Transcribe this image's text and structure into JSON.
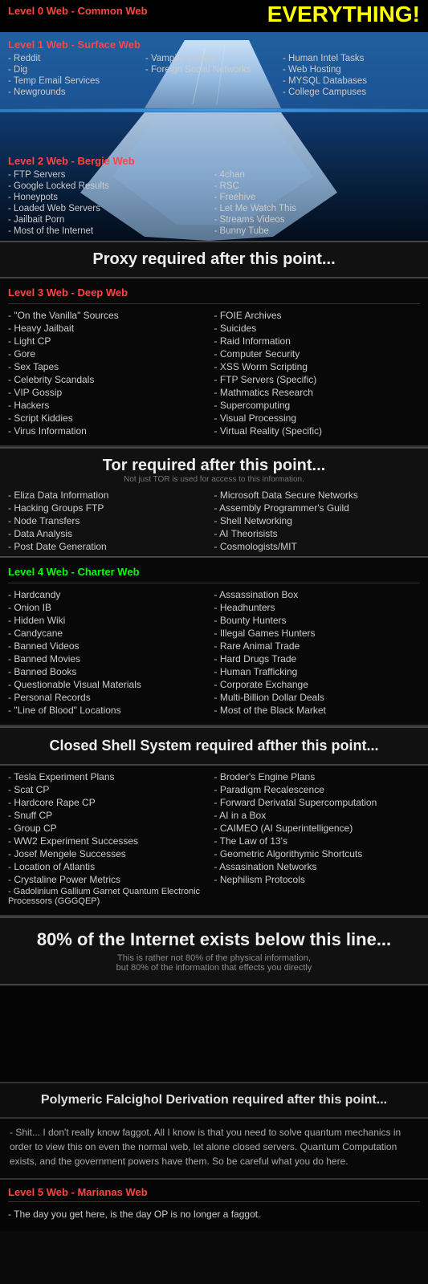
{
  "top": {
    "level0_label": "Level 0 Web - Common Web",
    "everything_label": "EVERYTHING!"
  },
  "level1": {
    "header": "Level 1 Web - Surface Web",
    "col1": [
      "- Reddit",
      "- Dig",
      "- Temp Email Services",
      "- Newgrounds"
    ],
    "col2": [
      "- Vampire Freaks",
      "- Foreign Social Networks"
    ],
    "col3": [
      "- Human Intel Tasks",
      "- Web Hosting",
      "- MYSQL Databases",
      "- College Campuses"
    ]
  },
  "level2": {
    "header": "Level 2 Web - Bergie Web",
    "col1": [
      "- FTP Servers",
      "- Google Locked Results",
      "- Honeypots",
      "- Loaded Web Servers",
      "- Jailbait Porn",
      "- Most of the Internet"
    ],
    "col2": [
      "- 4chan",
      "- RSC",
      "- Freehive",
      "- Let Me Watch This",
      "- Streams Videos",
      "- Bunny Tube"
    ]
  },
  "proxy_sep": {
    "title": "Proxy required after this point..."
  },
  "level3": {
    "header": "Level 3 Web - Deep Web",
    "col1": [
      "- \"On the Vanilla\" Sources",
      "- Heavy Jailbait",
      "- Light CP",
      "- Gore",
      "- Sex Tapes",
      "- Celebrity Scandals",
      "- VIP Gossip",
      "- Hackers",
      "- Script Kiddies",
      "- Virus Information"
    ],
    "col2": [
      "- FOIE Archives",
      "- Suicides",
      "- Raid Information",
      "- Computer Security",
      "- XSS Worm Scripting",
      "- FTP Servers (Specific)",
      "- Mathmatics Research",
      "- Supercomputing",
      "- Visual Processing",
      "- Virtual Reality (Specific)"
    ]
  },
  "tor_sep": {
    "title": "Tor required after this point...",
    "subtitle": "Not just TOR is used for access to this information.",
    "col1": [
      "- Eliza Data Information",
      "- Hacking Groups FTP",
      "- Node Transfers",
      "- Data Analysis",
      "- Post Date Generation"
    ],
    "col2": [
      "- Microsoft Data Secure Networks",
      "- Assembly Programmer's Guild",
      "- Shell Networking",
      "- AI Theorisists",
      "- Cosmologists/MIT"
    ]
  },
  "level4": {
    "header": "Level 4 Web - Charter Web",
    "col1": [
      "- Hardcandy",
      "- Onion IB",
      "- Hidden Wiki",
      "- Candycane",
      "- Banned Videos",
      "- Banned Movies",
      "- Banned Books",
      "- Questionable Visual Materials",
      "- Personal Records",
      "- \"Line of Blood\" Locations"
    ],
    "col2": [
      "- Assassination Box",
      "- Headhunters",
      "- Bounty Hunters",
      "- Illegal Games Hunters",
      "- Rare Animal Trade",
      "- Hard Drugs Trade",
      "- Human Trafficking",
      "- Corporate Exchange",
      "- Multi-Billion Dollar Deals",
      "- Most of the Black Market"
    ]
  },
  "closed_shell_sep": {
    "title": "Closed Shell System required afther this point..."
  },
  "closed_shell": {
    "col1": [
      "- Tesla Experiment Plans",
      "- Scat CP",
      "- Hardcore Rape CP",
      "- Snuff CP",
      "- Group CP",
      "- WW2 Experiment Successes",
      "- Josef Mengele Successes",
      "- Location of Atlantis",
      "- Crystaline Power Metrics",
      "- Gadolinium Gallium Garnet Quantum Electronic Processors (GGGQEP)"
    ],
    "col2": [
      "- Broder's Engine Plans",
      "- Paradigm Recalescence",
      "- Forward Derivatal Supercomputation",
      "- AI in a Box",
      "- CAIMEO (AI Superintelligence)",
      "- The Law of 13's",
      "- Geometric Algorithymic Shortcuts",
      "- Assasination Networks",
      "- Nephilism Protocols"
    ]
  },
  "eighty_sep": {
    "title": "80% of the Internet exists below this line...",
    "subtitle": "This is rather not 80% of the physical information,\nbut 80% of the information that effects you directly"
  },
  "polymeric_sep": {
    "title": "Polymeric Falcighol Derivation required after this point..."
  },
  "polymeric_text": "- Shit... I don't really know faggot. All I know is that you need to solve quantum mechanics in order to view this on even the normal web, let alone closed servers. Quantum Computation exists, and the government powers have them. So be careful what you do here.",
  "level5": {
    "header": "Level 5 Web - Marianas Web",
    "items": [
      "- The day you get here, is the day OP is no longer a faggot."
    ]
  }
}
